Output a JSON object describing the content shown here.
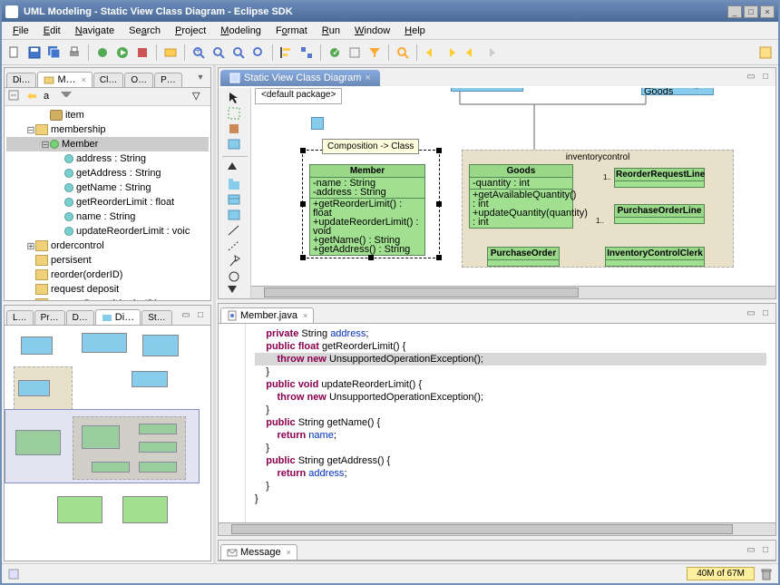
{
  "window_title": "UML Modeling - Static View Class Diagram - Eclipse SDK",
  "menus": [
    "File",
    "Edit",
    "Navigate",
    "Search",
    "Project",
    "Modeling",
    "Format",
    "Run",
    "Window",
    "Help"
  ],
  "left_top_tabs": [
    "Di…",
    "M…",
    "Cl…",
    "O…",
    "P…"
  ],
  "left_top_active": 1,
  "tree": [
    {
      "indent": 1,
      "icon": "pkg",
      "label": "item"
    },
    {
      "indent": 0,
      "icon": "folder",
      "label": "membership",
      "exp": "-"
    },
    {
      "indent": 1,
      "icon": "class",
      "label": "Member",
      "exp": "-",
      "sel": true
    },
    {
      "indent": 2,
      "icon": "attr",
      "label": "address : String"
    },
    {
      "indent": 2,
      "icon": "attr",
      "label": "getAddress : String"
    },
    {
      "indent": 2,
      "icon": "attr",
      "label": "getName : String"
    },
    {
      "indent": 2,
      "icon": "attr",
      "label": "getReorderLimit : float"
    },
    {
      "indent": 2,
      "icon": "attr",
      "label": "name : String"
    },
    {
      "indent": 2,
      "icon": "attr",
      "label": "updateReorderLimit : voic"
    },
    {
      "indent": 0,
      "icon": "folder",
      "label": "ordercontrol",
      "exp": "+"
    },
    {
      "indent": 0,
      "icon": "folder",
      "label": "persisent"
    },
    {
      "indent": 0,
      "icon": "folder",
      "label": "reorder(orderID)"
    },
    {
      "indent": 0,
      "icon": "folder",
      "label": "request deposit"
    },
    {
      "indent": 0,
      "icon": "folder",
      "label": "requestDeposit(orderID)"
    }
  ],
  "left_bottom_tabs": [
    "L…",
    "Pr…",
    "D…",
    "Di…",
    "St…"
  ],
  "left_bottom_active": 3,
  "diagram_tab": "Static View Class Diagram",
  "breadcrumb": "<default package>",
  "tooltip": "Composition -> Class",
  "uml": {
    "member": {
      "name": "Member",
      "attrs": [
        "-name : String",
        "-address : String"
      ],
      "ops": [
        "+getReorderLimit() : float",
        "+updateReorderLimit() : void",
        "+getName() : String",
        "+getAddress() : String"
      ]
    },
    "goods": {
      "name": "Goods",
      "attrs": [
        "-quantity : int"
      ],
      "ops": [
        "+getAvailableQuantity() : int",
        "+updateQuantity(quantity) : int"
      ]
    },
    "reorder": {
      "name": "ReorderRequestLine"
    },
    "poline": {
      "name": "PurchaseOrderLine"
    },
    "po": {
      "name": "PurchaseOrder"
    },
    "clerk": {
      "name": "InventoryControlClerk"
    },
    "container": "inventorycontrol",
    "top1_ops": "+getGoods() : Goods"
  },
  "mult": {
    "one": "1",
    "one2": "1.."
  },
  "editor_tab": "Member.java",
  "code_tokens": {
    "private": "private",
    "public": "public",
    "float": "float",
    "void": "void",
    "string": "String",
    "throw": "throw",
    "new": "new",
    "return": "return",
    "address": "address",
    "name": "name",
    "getReorderLimit": "getReorderLimit",
    "updateReorderLimit": "updateReorderLimit",
    "getName": "getName",
    "getAddress": "getAddress",
    "exc": "UnsupportedOperationException"
  },
  "message_tab": "Message",
  "memory": "40M of 67M"
}
